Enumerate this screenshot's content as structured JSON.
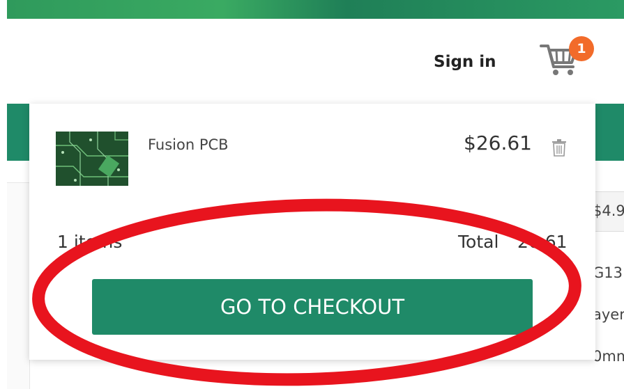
{
  "header": {
    "sign_in_label": "Sign in",
    "cart_count": "1"
  },
  "cart_dropdown": {
    "item": {
      "name": "Fusion PCB",
      "price": "$26.61"
    },
    "item_count_label": "1 items",
    "total_label": "Total",
    "total_value": "26.61",
    "checkout_label": "GO TO CHECKOUT"
  },
  "background_partial": {
    "price_fragment": "$4.9",
    "line_1": "G13",
    "line_2": "ayer",
    "line_3": "0mm"
  },
  "colors": {
    "brand_green": "#1f8a68",
    "badge_orange": "#f26b2a",
    "annotation_red": "#e8141e"
  },
  "icons": [
    "cart-icon",
    "trash-icon"
  ]
}
